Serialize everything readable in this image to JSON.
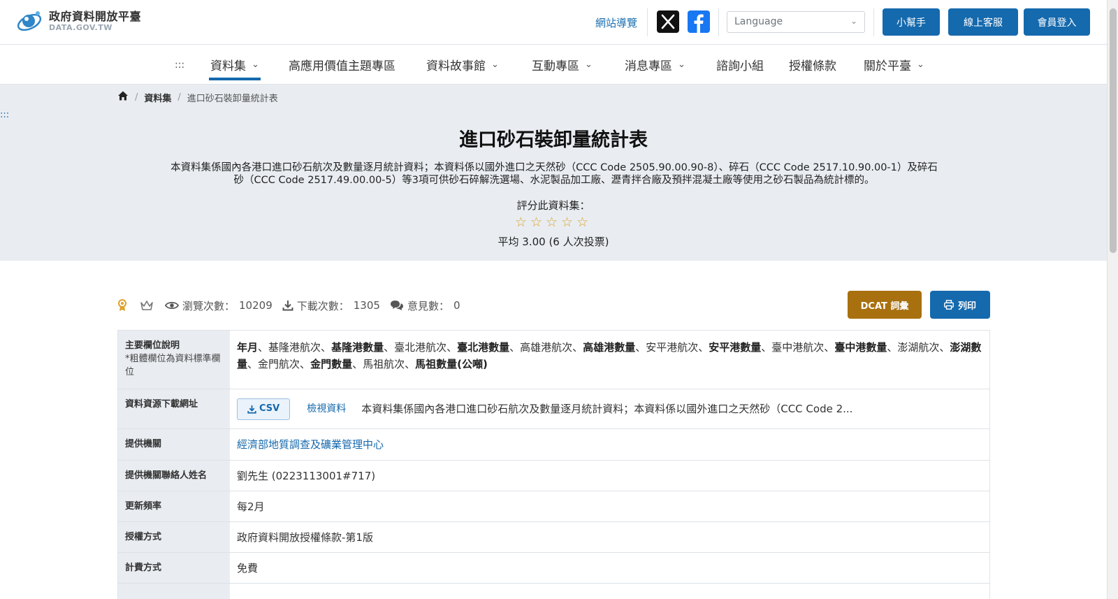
{
  "header": {
    "logo_title": "政府資料開放平臺",
    "logo_sub": "DATA.GOV.TW",
    "sitemap_label": "網站導覽",
    "language_placeholder": "Language",
    "helper_label": "小幫手",
    "support_label": "線上客服",
    "login_label": "會員登入"
  },
  "nav": {
    "skip": ":::",
    "items": [
      {
        "label": "資料集"
      },
      {
        "label": "高應用價值主題專區"
      },
      {
        "label": "資料故事館"
      },
      {
        "label": "互動專區"
      },
      {
        "label": "消息專區"
      },
      {
        "label": "諮詢小組"
      },
      {
        "label": "授權條款"
      },
      {
        "label": "關於平臺"
      }
    ]
  },
  "breadcrumb": {
    "items": [
      "資料集",
      "進口砂石裝卸量統計表"
    ]
  },
  "hero": {
    "skip": ":::",
    "title": "進口砂石裝卸量統計表",
    "description": "本資料集係國內各港口進口砂石航次及數量逐月統計資料；本資料係以國外進口之天然砂（CCC Code 2505.90.00.90-8）、碎石（CCC Code 2517.10.90.00-1）及碎石砂（CCC Code 2517.49.00.00-5）等3項可供砂石碎解洗選場、水泥製品加工廠、瀝青拌合廠及預拌混凝土廠等使用之砂石製品為統計標的。",
    "rate_label": "評分此資料集：",
    "stars": "☆☆☆☆☆",
    "average": "平均 3.00 (6 人次投票)"
  },
  "stats": {
    "views_label": "瀏覽次數：",
    "views": "10209",
    "downloads_label": "下載次數：",
    "downloads": "1305",
    "comments_label": "意見數：",
    "comments": "0"
  },
  "actions": {
    "dcat_label": "DCAT 詞彙",
    "print_label": "列印"
  },
  "details": {
    "fields_label": "主要欄位說明",
    "fields_note": "*粗體欄位為資料標準欄位",
    "fields": [
      {
        "text": "年月",
        "bold": true
      },
      {
        "text": "基隆港航次",
        "bold": false
      },
      {
        "text": "基隆港數量",
        "bold": true
      },
      {
        "text": "臺北港航次",
        "bold": false
      },
      {
        "text": "臺北港數量",
        "bold": true
      },
      {
        "text": "高雄港航次",
        "bold": false
      },
      {
        "text": "高雄港數量",
        "bold": true
      },
      {
        "text": "安平港航次",
        "bold": false
      },
      {
        "text": "安平港數量",
        "bold": true
      },
      {
        "text": "臺中港航次",
        "bold": false
      },
      {
        "text": "臺中港數量",
        "bold": true
      },
      {
        "text": "澎湖航次",
        "bold": false
      },
      {
        "text": "澎湖數量",
        "bold": true
      },
      {
        "text": "金門航次",
        "bold": false
      },
      {
        "text": "金門數量",
        "bold": true
      },
      {
        "text": "馬祖航次",
        "bold": false
      },
      {
        "text": "馬祖數量(公噸)",
        "bold": true
      }
    ],
    "resource_label": "資料資源下載網址",
    "csv_label": "CSV",
    "view_label": "檢視資料",
    "resource_desc": "本資料集係國內各港口進口砂石航次及數量逐月統計資料；本資料係以國外進口之天然砂（CCC Code 2...",
    "provider_label": "提供機關",
    "provider": "經濟部地質調查及礦業管理中心",
    "contact_label": "提供機關聯絡人姓名",
    "contact": "劉先生 (0223113001#717)",
    "frequency_label": "更新頻率",
    "frequency": "每2月",
    "license_label": "授權方式",
    "license": "政府資料開放授權條款-第1版",
    "fee_label": "計費方式",
    "fee": "免費"
  },
  "colors": {
    "primary": "#1569ad",
    "dcat": "#a8700f",
    "hero_bg": "#e9edf1",
    "star": "#d9a32b"
  }
}
